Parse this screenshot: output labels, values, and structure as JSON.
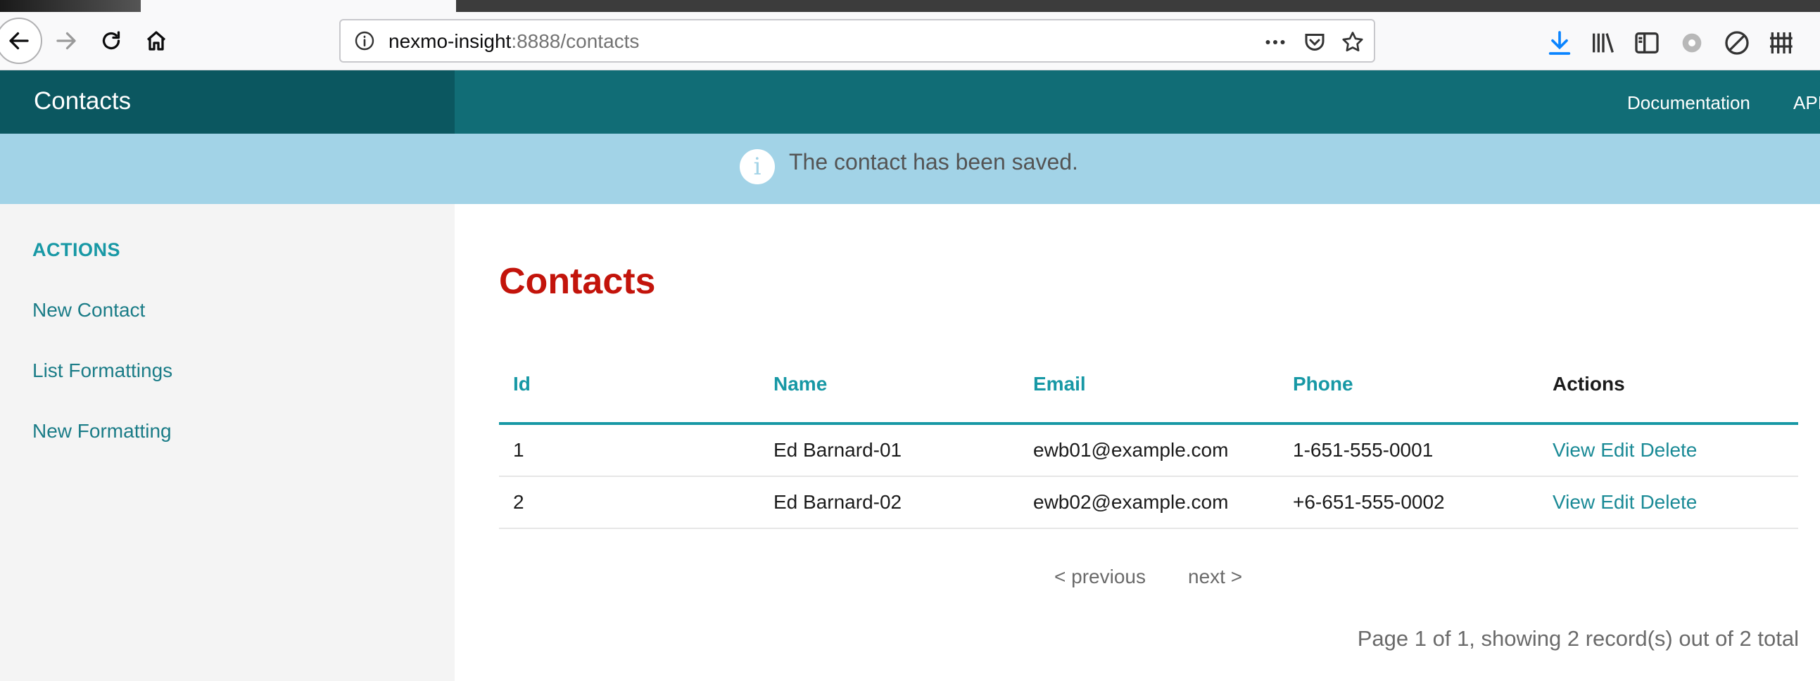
{
  "browser": {
    "url_host": "nexmo-insight",
    "url_rest": ":8888/contacts"
  },
  "header": {
    "brand": "Contacts",
    "nav": [
      "Documentation",
      "API"
    ]
  },
  "flash": {
    "icon": "info-icon",
    "message": "The contact has been saved."
  },
  "sidebar": {
    "heading": "ACTIONS",
    "items": [
      "New Contact",
      "List Formattings",
      "New Formatting"
    ]
  },
  "main": {
    "title": "Contacts",
    "columns": [
      "Id",
      "Name",
      "Email",
      "Phone",
      "Actions"
    ],
    "rows": [
      {
        "id": "1",
        "name": "Ed Barnard-01",
        "email": "ewb01@example.com",
        "phone": "1-651-555-0001"
      },
      {
        "id": "2",
        "name": "Ed Barnard-02",
        "email": "ewb02@example.com",
        "phone": "+6-651-555-0002"
      }
    ],
    "actions": {
      "view": "View",
      "edit": "Edit",
      "delete": "Delete"
    },
    "pager": {
      "previous": "< previous",
      "next": "next >"
    },
    "summary": "Page 1 of 1, showing 2 record(s) out of 2 total"
  },
  "colors": {
    "header_bg": "#116d76",
    "brand_bg": "#0b5760",
    "flash_bg": "#a2d3e7",
    "accent": "#1798a5",
    "title_red": "#c3140b"
  }
}
